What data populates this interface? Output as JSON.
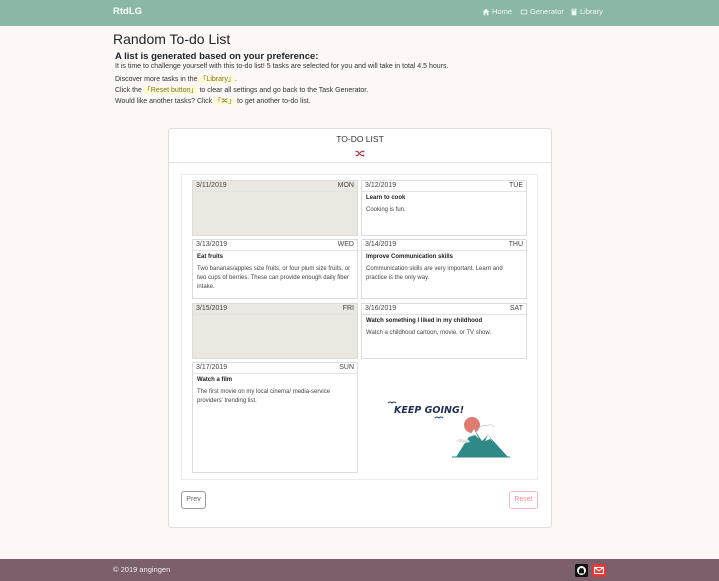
{
  "nav": {
    "brand": "RtdLG",
    "home": "Home",
    "generator": "Generator",
    "library": "Library"
  },
  "page": {
    "title": "Random To-do List",
    "intro_heading": "A list is generated based on your preference:",
    "line1": "It is time to challenge yourself with this to-do list! 5 tasks are selected for you and will take in total 4.5 hours.",
    "line2_pre": "Discover more tasks in the ",
    "line2_hl": "「Library」",
    "line2_post": ".",
    "line3_pre": "Click the ",
    "line3_hl": "「Reset button」",
    "line3_post": " to clear all settings and go back to the Task Generator.",
    "line4_pre": "Would like another tasks? Click ",
    "line4_hl_open": "「",
    "line4_hl_close": "」",
    "line4_post": " to get another to-do list."
  },
  "todo": {
    "title": "TO-DO LIST",
    "days": [
      {
        "date": "3/11/2019",
        "dow": "MON",
        "task": "",
        "desc": ""
      },
      {
        "date": "3/12/2019",
        "dow": "TUE",
        "task": "Learn to cook",
        "desc": "Cooking is fun."
      },
      {
        "date": "3/13/2019",
        "dow": "WED",
        "task": "Eat fruits",
        "desc": "Two bananas/apples size fruits, or four plum size fruits, or two cups of berries. These can provide enough daily fiber intake."
      },
      {
        "date": "3/14/2019",
        "dow": "THU",
        "task": "Improve Communication skills",
        "desc": "Communication skills are very important. Learn and practice is the only way."
      },
      {
        "date": "3/15/2019",
        "dow": "FRI",
        "task": "",
        "desc": ""
      },
      {
        "date": "3/16/2019",
        "dow": "SAT",
        "task": "Watch something I liked in my childhood",
        "desc": "Watch a childhood cartoon, movie, or TV show."
      },
      {
        "date": "3/17/2019",
        "dow": "SUN",
        "task": "Watch a film",
        "desc": "The first movie on my local cinema/ media-service providers' trending list."
      }
    ],
    "illustration_text": "KEEP GOING!",
    "prev_label": "Prev",
    "reset_label": "Reset"
  },
  "footer": {
    "copyright": "© 2019 angingen"
  },
  "colors": {
    "navbar": "#8bb8a6",
    "footer": "#7c5f6c",
    "weekend_cell": "#ebe8e2",
    "highlight": "#fdfbd2",
    "reset": "#ef8d9d"
  }
}
